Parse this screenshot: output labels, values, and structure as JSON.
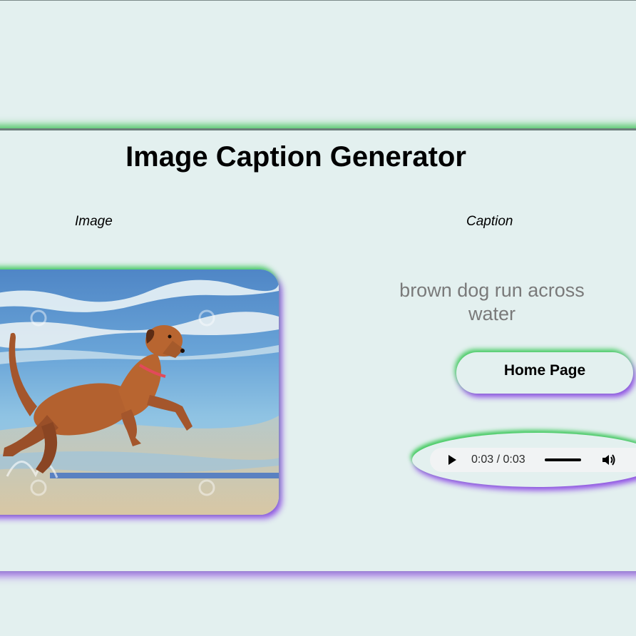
{
  "page": {
    "title": "Image Caption Generator",
    "labels": {
      "image": "Image",
      "caption": "Caption"
    }
  },
  "result": {
    "caption": "brown dog run across water",
    "image_alt": "brown dog running across shallow beach water"
  },
  "actions": {
    "home_label": "Home Page"
  },
  "audio": {
    "time": "0:03 / 0:03",
    "progress": 1.0
  },
  "colors": {
    "background": "#e3f0ef",
    "glow_green": "#3cc850",
    "glow_purple": "#8c46e6",
    "caption_text": "#7a7a7a"
  },
  "icons": [
    "play-icon",
    "volume-icon"
  ]
}
